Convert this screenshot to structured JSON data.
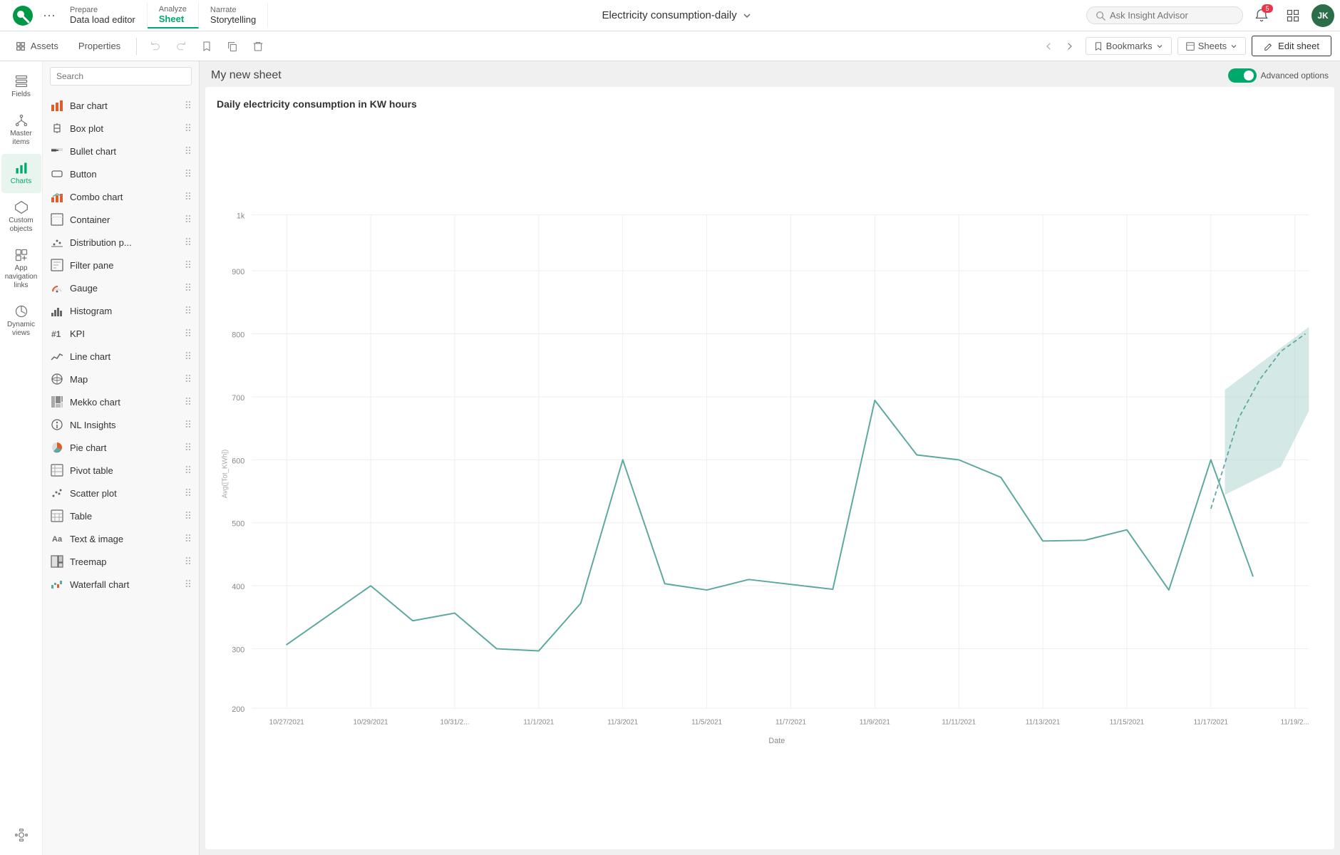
{
  "app": {
    "title": "Electricity consumption-daily",
    "logo_alt": "Qlik"
  },
  "nav": {
    "prepare_label": "Prepare",
    "prepare_sub": "Data load editor",
    "analyze_label": "Analyze",
    "analyze_sub": "Sheet",
    "narrate_label": "Narrate",
    "narrate_sub": "Storytelling"
  },
  "toolbar2": {
    "assets_label": "Assets",
    "properties_label": "Properties",
    "undo_label": "Undo",
    "redo_label": "Redo",
    "bookmarks_label": "Bookmarks",
    "sheets_label": "Sheets",
    "edit_sheet_label": "Edit sheet"
  },
  "search": {
    "placeholder": "Ask Insight Advisor"
  },
  "sidebar": {
    "items": [
      {
        "id": "fields",
        "label": "Fields"
      },
      {
        "id": "master-items",
        "label": "Master items"
      },
      {
        "id": "charts",
        "label": "Charts"
      },
      {
        "id": "custom-objects",
        "label": "Custom objects"
      },
      {
        "id": "app-nav",
        "label": "App navigation links"
      },
      {
        "id": "dynamic-views",
        "label": "Dynamic views"
      }
    ]
  },
  "charts_panel": {
    "search_placeholder": "Search",
    "items": [
      {
        "id": "bar-chart",
        "label": "Bar chart",
        "icon": "bar"
      },
      {
        "id": "box-plot",
        "label": "Box plot",
        "icon": "box"
      },
      {
        "id": "bullet-chart",
        "label": "Bullet chart",
        "icon": "bullet"
      },
      {
        "id": "button",
        "label": "Button",
        "icon": "button"
      },
      {
        "id": "combo-chart",
        "label": "Combo chart",
        "icon": "combo"
      },
      {
        "id": "container",
        "label": "Container",
        "icon": "container"
      },
      {
        "id": "distribution-p",
        "label": "Distribution p...",
        "icon": "dist"
      },
      {
        "id": "filter-pane",
        "label": "Filter pane",
        "icon": "filter"
      },
      {
        "id": "gauge",
        "label": "Gauge",
        "icon": "gauge"
      },
      {
        "id": "histogram",
        "label": "Histogram",
        "icon": "histogram"
      },
      {
        "id": "kpi",
        "label": "KPI",
        "icon": "kpi"
      },
      {
        "id": "line-chart",
        "label": "Line chart",
        "icon": "line"
      },
      {
        "id": "map",
        "label": "Map",
        "icon": "map"
      },
      {
        "id": "mekko-chart",
        "label": "Mekko chart",
        "icon": "mekko"
      },
      {
        "id": "nl-insights",
        "label": "NL Insights",
        "icon": "nl"
      },
      {
        "id": "pie-chart",
        "label": "Pie chart",
        "icon": "pie"
      },
      {
        "id": "pivot-table",
        "label": "Pivot table",
        "icon": "pivot"
      },
      {
        "id": "scatter-plot",
        "label": "Scatter plot",
        "icon": "scatter"
      },
      {
        "id": "table",
        "label": "Table",
        "icon": "table"
      },
      {
        "id": "text-image",
        "label": "Text & image",
        "icon": "text"
      },
      {
        "id": "treemap",
        "label": "Treemap",
        "icon": "treemap"
      },
      {
        "id": "waterfall-chart",
        "label": "Waterfall chart",
        "icon": "waterfall"
      }
    ]
  },
  "sheet": {
    "title": "My new sheet",
    "chart_title": "Daily electricity consumption in KW hours",
    "advanced_options_label": "Advanced options",
    "y_axis_label": "Avg([Tot_KWh])",
    "x_axis_label": "Date",
    "y_values": [
      "1k",
      "900",
      "800",
      "700",
      "600",
      "500",
      "400",
      "300",
      "200"
    ],
    "x_labels": [
      "10/27/2021",
      "10/29/2021",
      "10/31/2...",
      "11/1/2021",
      "11/3/2021",
      "11/5/2021",
      "11/7/2021",
      "11/9/2021",
      "11/11/2021",
      "11/13/2021",
      "11/15/2021",
      "11/17/2021",
      "11/19/2..."
    ]
  },
  "colors": {
    "accent": "#00a86b",
    "line": "#5ba8a0",
    "forecast_fill": "#b8d8d4",
    "forecast_stroke": "#5ba8a0"
  }
}
